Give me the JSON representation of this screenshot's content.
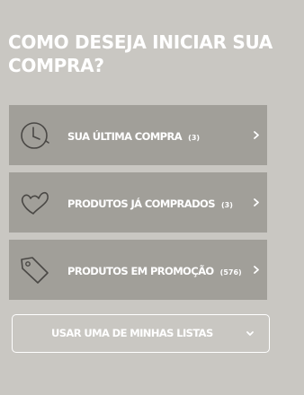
{
  "header": {
    "title": "COMO DESEJA INICIAR SUA COMPRA?"
  },
  "options": [
    {
      "label": "SUA ÚLTIMA COMPRA",
      "count": "(3)",
      "icon": "clock-icon"
    },
    {
      "label": "PRODUTOS JÁ COMPRADOS",
      "count": "(3)",
      "icon": "heart-icon"
    },
    {
      "label": "PRODUTOS EM PROMOÇÃO",
      "count": "(576)",
      "icon": "price-tag-icon"
    }
  ],
  "lists_select": {
    "label": "USAR UMA DE MINHAS LISTAS",
    "icon": "chevron-down-icon"
  },
  "colors": {
    "background": "#c9c7c2",
    "option_background": "#a19f99",
    "text": "#ffffff",
    "icon_stroke": "#4a4845"
  }
}
